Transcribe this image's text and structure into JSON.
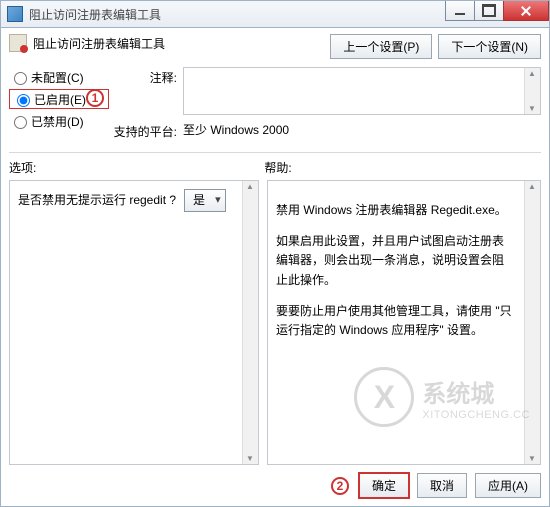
{
  "window": {
    "title": "阻止访问注册表编辑工具"
  },
  "header": {
    "heading": "阻止访问注册表编辑工具",
    "prev_btn": "上一个设置(P)",
    "next_btn": "下一个设置(N)"
  },
  "config": {
    "radios": {
      "not_configured": "未配置(C)",
      "enabled": "已启用(E)",
      "disabled": "已禁用(D)"
    },
    "selected": "enabled",
    "comment_label": "注释:",
    "platform_label": "支持的平台:",
    "platform_value": "至少 Windows 2000"
  },
  "section_labels": {
    "options": "选项:",
    "help": "帮助:"
  },
  "options_panel": {
    "question": "是否禁用无提示运行 regedit ?",
    "select_value": "是"
  },
  "help_panel": {
    "p1": "禁用 Windows 注册表编辑器 Regedit.exe。",
    "p2": "如果启用此设置，并且用户试图启动注册表编辑器，则会出现一条消息，说明设置会阻止此操作。",
    "p3": "要要防止用户使用其他管理工具，请使用 \"只运行指定的 Windows 应用程序\" 设置。"
  },
  "footer": {
    "ok": "确定",
    "cancel": "取消",
    "apply": "应用(A)"
  },
  "markers": {
    "m1": "1",
    "m2": "2"
  },
  "watermark": {
    "cn": "系统城",
    "en": "XITONGCHENG.CC"
  }
}
